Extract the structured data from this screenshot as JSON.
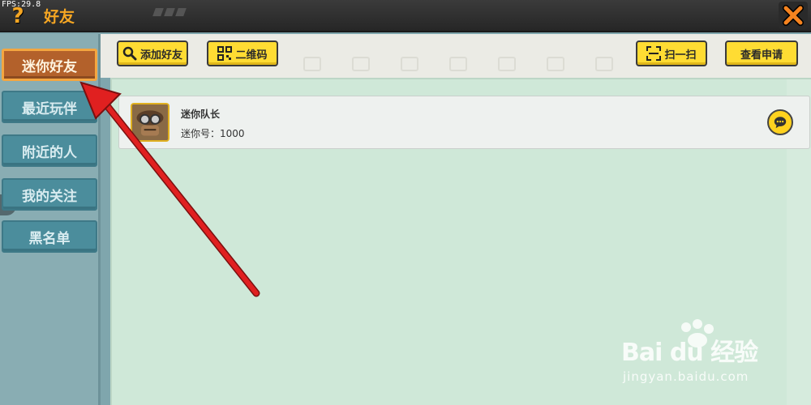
{
  "titlebar": {
    "fps_text": "FPS:29.8",
    "help_glyph": "?",
    "title": "好友",
    "close_icon": "close-icon"
  },
  "sidebar": {
    "items": [
      {
        "label": "迷你好友",
        "active": true
      },
      {
        "label": "最近玩伴",
        "active": false
      },
      {
        "label": "附近的人",
        "active": false
      },
      {
        "label": "我的关注",
        "active": false
      },
      {
        "label": "黑名单",
        "active": false
      }
    ]
  },
  "toolbar": {
    "add_friend": "添加好友",
    "qr_code": "二维码",
    "scan": "扫一扫",
    "view_requests": "查看申请"
  },
  "friends": [
    {
      "name": "迷你队长",
      "mini_id_label": "迷你号：1000",
      "avatar_icon": "pilot-avatar-icon"
    }
  ],
  "colors": {
    "accent_orange": "#f5a623",
    "button_yellow": "#ffdc33",
    "active_tab": "#b3612b",
    "tab_teal": "#4b8d9c",
    "content_bg": "#cfe8d8",
    "annotation_arrow": "#e02020"
  },
  "watermark": {
    "logo": "Bai du 经验",
    "url": "jingyan.baidu.com"
  }
}
